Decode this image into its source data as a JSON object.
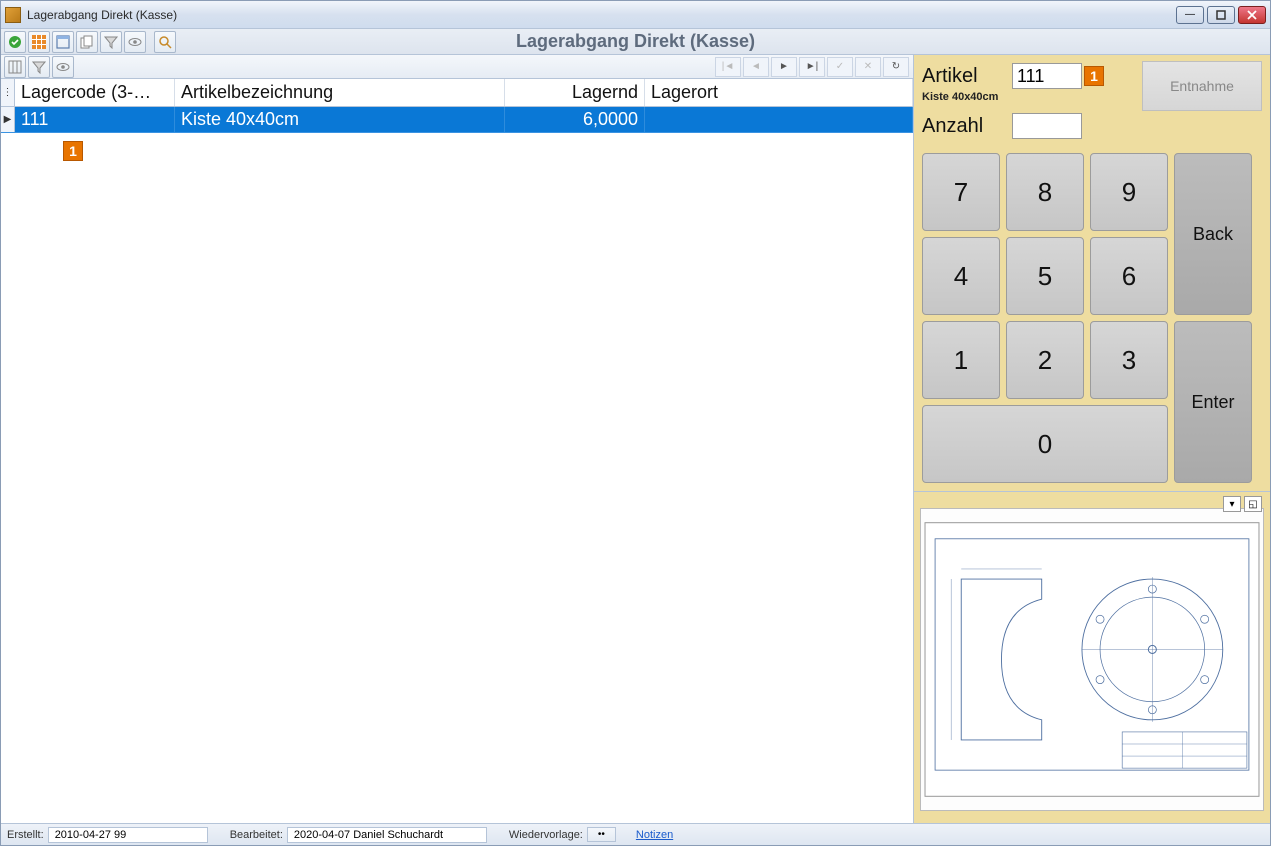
{
  "window": {
    "title": "Lagerabgang Direkt (Kasse)",
    "header_title": "Lagerabgang Direkt (Kasse)"
  },
  "toolbar": {
    "icons": [
      "ok",
      "grid-dark",
      "grid-light",
      "copy",
      "filter",
      "eye",
      "find"
    ]
  },
  "grid_toolbar": {
    "icons": [
      "columns",
      "filter",
      "eye"
    ],
    "nav": [
      "first",
      "prev",
      "next",
      "last",
      "accept",
      "cancel",
      "refresh"
    ]
  },
  "grid": {
    "columns": {
      "code": "Lagercode (3-…",
      "desc": "Artikelbezeichnung",
      "qty": "Lagernd",
      "loc": "Lagerort"
    },
    "rows": [
      {
        "code": "111",
        "desc": "Kiste 40x40cm",
        "qty": "6,0000",
        "loc": ""
      }
    ]
  },
  "annotations": {
    "row_badge": "1",
    "artikel_badge": "1"
  },
  "panel": {
    "artikel_label": "Artikel",
    "artikel_value": "111",
    "artikel_sub": "Kiste 40x40cm",
    "anzahl_label": "Anzahl",
    "anzahl_value": "",
    "withdraw": "Entnahme"
  },
  "keypad": {
    "k7": "7",
    "k8": "8",
    "k9": "9",
    "back": "Back",
    "k4": "4",
    "k5": "5",
    "k6": "6",
    "k1": "1",
    "k2": "2",
    "k3": "3",
    "enter": "Enter",
    "k0": "0"
  },
  "status": {
    "created_label": "Erstellt:",
    "created_value": "2010-04-27  99",
    "edited_label": "Bearbeitet:",
    "edited_value": "2020-04-07  Daniel Schuchardt",
    "resub_label": "Wiedervorlage:",
    "resub_btn": "••",
    "notes": "Notizen"
  }
}
